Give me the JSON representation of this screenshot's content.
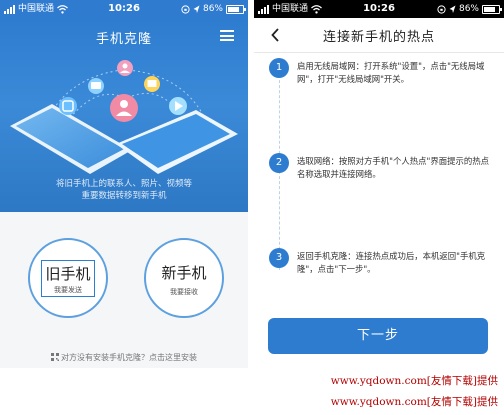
{
  "status_bar": {
    "carrier": "中国联通",
    "time": "10:26",
    "battery": "86%"
  },
  "left_screen": {
    "title": "手机克隆",
    "transfer_caption": "将旧手机上的联系人、照片、视频等\n重要数据转移到新手机",
    "old_phone": {
      "label": "旧手机",
      "sublabel": "我要发送"
    },
    "new_phone": {
      "label": "新手机",
      "sublabel": "我要接收"
    },
    "install_hint": "对方没有安装手机克隆？点击这里安装"
  },
  "right_screen": {
    "title": "连接新手机的热点",
    "steps": [
      {
        "num": "1",
        "text": "启用无线局域网：打开系统\"设置\"，点击\"无线局域网\"，打开\"无线局域网\"开关。"
      },
      {
        "num": "2",
        "text": "选取网络：按照对方手机\"个人热点\"界面提示的热点名称选取并连接网络。"
      },
      {
        "num": "3",
        "text": "返回手机克隆：连接热点成功后，本机返回\"手机克隆\"，点击\"下一步\"。"
      }
    ],
    "next_button": "下一步"
  },
  "watermark": "www.yqdown.com[友情下载]提供",
  "colors": {
    "brand_blue": "#2e7ccf",
    "watermark_red": "#b30000"
  }
}
